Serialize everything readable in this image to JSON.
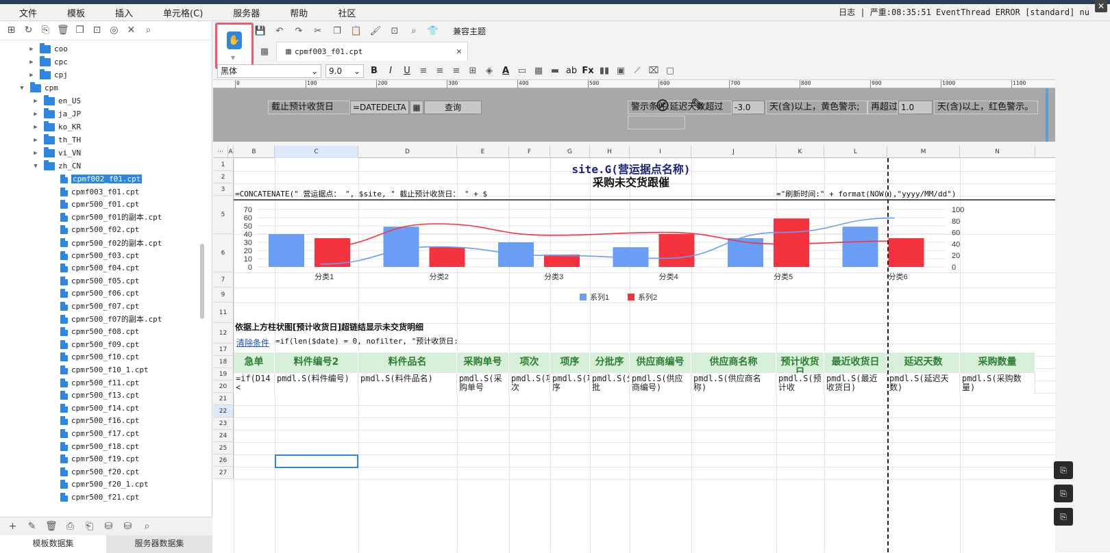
{
  "menu": [
    "文件",
    "模板",
    "插入",
    "单元格(C)",
    "服务器",
    "帮助",
    "社区"
  ],
  "log_text": "日志 | 严重:08:35:51 EventThread ERROR [standard] nu",
  "tree": {
    "folders": [
      "coo",
      "cpc",
      "cpj",
      "cpm",
      "en_US",
      "ja_JP",
      "ko_KR",
      "th_TH",
      "vi_VN",
      "zh_CN"
    ],
    "files": [
      "cpmf002_f01.cpt",
      "cpmf003_f01.cpt",
      "cpmr500_f01.cpt",
      "cpmr500_f01的副本.cpt",
      "cpmr500_f02.cpt",
      "cpmr500_f02的副本.cpt",
      "cpmr500_f03.cpt",
      "cpmr500_f04.cpt",
      "cpmr500_f05.cpt",
      "cpmr500_f06.cpt",
      "cpmr500_f07.cpt",
      "cpmr500_f07的副本.cpt",
      "cpmr500_f08.cpt",
      "cpmr500_f09.cpt",
      "cpmr500_f10.cpt",
      "cpmr500_f10_1.cpt",
      "cpmr500_f11.cpt",
      "cpmr500_f13.cpt",
      "cpmr500_f14.cpt",
      "cpmr500_f16.cpt",
      "cpmr500_f17.cpt",
      "cpmr500_f18.cpt",
      "cpmr500_f19.cpt",
      "cpmr500_f20.cpt",
      "cpmr500_f20_1.cpt",
      "cpmr500_f21.cpt"
    ],
    "selected_file": "cpmf002_f01.cpt"
  },
  "bottom_tabs": [
    "模板数据集",
    "服务器数据集"
  ],
  "toolbar": {
    "theme_label": "兼容主题"
  },
  "doc_tab": "cpmf003_f01.cpt",
  "font": {
    "name": "黑体",
    "size": "9.0"
  },
  "ruler": [
    "0",
    "100",
    "200",
    "300",
    "400",
    "500",
    "600",
    "700",
    "800",
    "900",
    "1000",
    "1100"
  ],
  "param": {
    "label_date": "截止预计收货日",
    "input_date": "=DATEDELTA",
    "query_button": "查询",
    "warn_label": "警示条件:延迟天数超过",
    "warn_value1": "-3.0",
    "warn_text1": "天(含)以上，黄色警示;",
    "again_label": "再超过",
    "warn_value2": "1.0",
    "warn_text2": "天(含)以上，红色警示。"
  },
  "columns": [
    "A",
    "B",
    "C",
    "D",
    "E",
    "F",
    "G",
    "H",
    "I",
    "J",
    "K",
    "L",
    "M",
    "N"
  ],
  "rows": [
    "1",
    "2",
    "3",
    "5",
    "6",
    "7",
    "9",
    "11",
    "12",
    "17",
    "18",
    "19",
    "20",
    "21",
    "22",
    "23",
    "24",
    "25",
    "26",
    "27"
  ],
  "sheet": {
    "title1": "site.G(营运据点名称)",
    "title2": "采购未交货跟催",
    "formula_left": "=CONCATENATE(\"  营运据点：  \", $site, \"  截止预计收货日：  \" + $",
    "formula_right": "=\"刷新时间:\" + format(NOW(),\"yyyy/MM/dd\")",
    "detail_label": "依据上方柱状图[预计收货日]超链结显示未交货明细",
    "clear_link": "清除条件",
    "filter_formula": "=if(len($date) = 0, nofilter, \"预计收货日:"
  },
  "headers": [
    "急单",
    "料件编号2",
    "料件品名",
    "采购单号",
    "项次",
    "项序",
    "分批序",
    "供应商编号",
    "供应商名称",
    "预计收货日",
    "最近收货日",
    "延迟天数",
    "采购数量"
  ],
  "datarow": [
    "=if(D14 <",
    "pmdl.S(料件编号)",
    "pmdl.S(料件品名)",
    "pmdl.S(采购单号",
    "pmdl.S(项次",
    "pmdl.S(项序",
    "pmdl.S(分批",
    "pmdl.S(供应商编号)",
    "pmdl.S(供应商名称)",
    "pmdl.S(预计收",
    "pmdl.S(最近收货日)",
    "pmdl.S(延迟天数)",
    "pmdl.S(采购数量)"
  ],
  "chart_data": {
    "type": "bar",
    "categories": [
      "分类1",
      "分类2",
      "分类3",
      "分类4",
      "分类5",
      "分类6"
    ],
    "series": [
      {
        "name": "系列1",
        "values": [
          40,
          49,
          30,
          24,
          35,
          49
        ],
        "color": "#6a9ef5"
      },
      {
        "name": "系列2",
        "values": [
          35,
          24,
          15,
          40,
          59,
          35
        ],
        "color": "#f5333f"
      }
    ],
    "lines": [
      {
        "name": "系列1",
        "values": [
          5,
          35,
          20,
          15,
          60,
          85
        ],
        "color": "#6a9ef5"
      },
      {
        "name": "系列2",
        "values": [
          35,
          75,
          55,
          60,
          40,
          45
        ],
        "color": "#f5333f"
      }
    ],
    "ylim": [
      0,
      70
    ],
    "yticks": [
      "0",
      "10",
      "20",
      "30",
      "40",
      "50",
      "60",
      "70"
    ],
    "y2lim": [
      0,
      100
    ],
    "y2ticks": [
      "0",
      "20",
      "40",
      "60",
      "80",
      "100"
    ],
    "legend": "bottom"
  }
}
